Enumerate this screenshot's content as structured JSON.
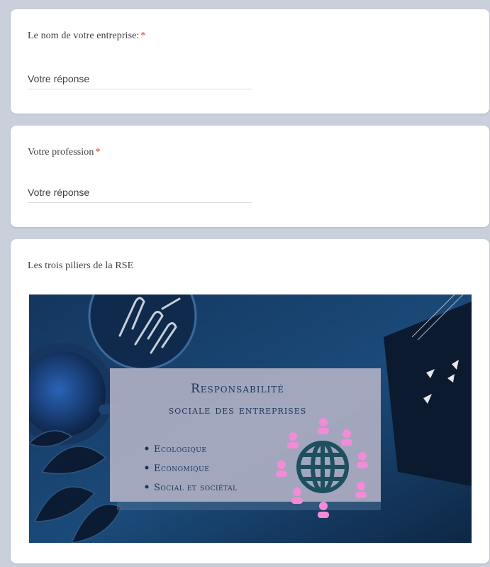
{
  "questions": [
    {
      "title": "Le nom de votre entreprise:",
      "required_mark": "*",
      "placeholder": "Votre réponse"
    },
    {
      "title": "Votre profession",
      "required_mark": "*",
      "placeholder": "Votre réponse"
    }
  ],
  "image_section": {
    "title": "Les trois piliers de la RSE",
    "image": {
      "heading_line1": "Responsabilité",
      "heading_line2": "sociale des entreprises",
      "bullets": [
        "Ecologique",
        "Economique",
        "Social et sociétal"
      ],
      "icon": "globe-with-people-icon"
    }
  },
  "colors": {
    "page_background": "#c9cfdb",
    "card_background": "#ffffff",
    "required_asterisk": "#d93025",
    "image_background": "#163a66",
    "panel_color": "#b8b6c8",
    "globe_color": "#1e4f5e",
    "people_color": "#f28bd8"
  }
}
